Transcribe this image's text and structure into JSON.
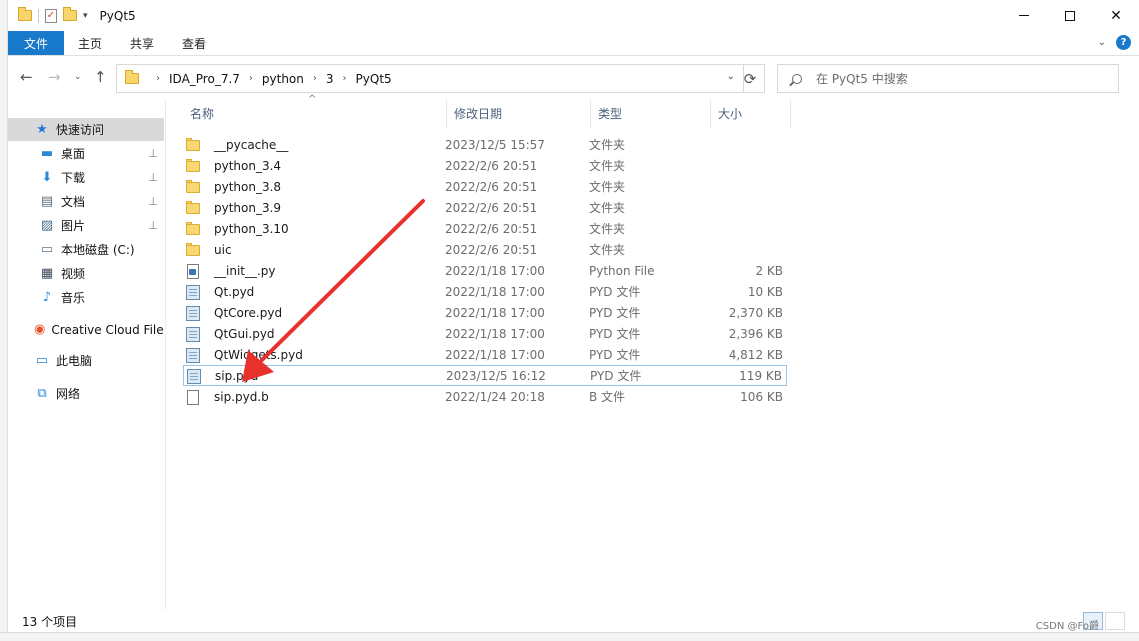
{
  "window": {
    "title": "PyQt5",
    "controls": {
      "minimize": "minimize",
      "maximize": "maximize",
      "close": "✕"
    }
  },
  "ribbon": {
    "tabs": [
      "文件",
      "主页",
      "共享",
      "查看"
    ],
    "help": "?"
  },
  "address": {
    "crumbs": [
      "IDA_Pro_7.7",
      "python",
      "3",
      "PyQt5"
    ]
  },
  "search": {
    "placeholder": "在 PyQt5 中搜索"
  },
  "nav": {
    "items": [
      {
        "label": "快速访问",
        "icon": "star-icon",
        "pinned": false
      },
      {
        "label": "桌面",
        "icon": "desktop-icon",
        "pinned": true
      },
      {
        "label": "下载",
        "icon": "download-icon",
        "pinned": true
      },
      {
        "label": "文档",
        "icon": "document-icon",
        "pinned": true
      },
      {
        "label": "图片",
        "icon": "pictures-icon",
        "pinned": true
      },
      {
        "label": "本地磁盘 (C:)",
        "icon": "drive-icon",
        "pinned": false
      },
      {
        "label": "视频",
        "icon": "video-icon",
        "pinned": false
      },
      {
        "label": "音乐",
        "icon": "music-icon",
        "pinned": false
      },
      {
        "label": "Creative Cloud Files",
        "icon": "creative-cloud-icon",
        "pinned": false
      },
      {
        "label": "此电脑",
        "icon": "computer-icon",
        "pinned": false
      },
      {
        "label": "网络",
        "icon": "network-icon",
        "pinned": false
      }
    ]
  },
  "columns": {
    "name": "名称",
    "date": "修改日期",
    "type": "类型",
    "size": "大小"
  },
  "files": [
    {
      "name": "__pycache__",
      "date": "2023/12/5 15:57",
      "type": "文件夹",
      "size": "",
      "icon": "folder"
    },
    {
      "name": "python_3.4",
      "date": "2022/2/6 20:51",
      "type": "文件夹",
      "size": "",
      "icon": "folder"
    },
    {
      "name": "python_3.8",
      "date": "2022/2/6 20:51",
      "type": "文件夹",
      "size": "",
      "icon": "folder"
    },
    {
      "name": "python_3.9",
      "date": "2022/2/6 20:51",
      "type": "文件夹",
      "size": "",
      "icon": "folder"
    },
    {
      "name": "python_3.10",
      "date": "2022/2/6 20:51",
      "type": "文件夹",
      "size": "",
      "icon": "folder"
    },
    {
      "name": "uic",
      "date": "2022/2/6 20:51",
      "type": "文件夹",
      "size": "",
      "icon": "folder"
    },
    {
      "name": "__init__.py",
      "date": "2022/1/18 17:00",
      "type": "Python File",
      "size": "2 KB",
      "icon": "py"
    },
    {
      "name": "Qt.pyd",
      "date": "2022/1/18 17:00",
      "type": "PYD 文件",
      "size": "10 KB",
      "icon": "pyd"
    },
    {
      "name": "QtCore.pyd",
      "date": "2022/1/18 17:00",
      "type": "PYD 文件",
      "size": "2,370 KB",
      "icon": "pyd"
    },
    {
      "name": "QtGui.pyd",
      "date": "2022/1/18 17:00",
      "type": "PYD 文件",
      "size": "2,396 KB",
      "icon": "pyd"
    },
    {
      "name": "QtWidgets.pyd",
      "date": "2022/1/18 17:00",
      "type": "PYD 文件",
      "size": "4,812 KB",
      "icon": "pyd"
    },
    {
      "name": "sip.pyd",
      "date": "2023/12/5 16:12",
      "type": "PYD 文件",
      "size": "119 KB",
      "icon": "pyd",
      "focused": true
    },
    {
      "name": "sip.pyd.b",
      "date": "2022/1/24 20:18",
      "type": "B 文件",
      "size": "106 KB",
      "icon": "doc"
    }
  ],
  "status": {
    "count": "13 个项目"
  },
  "watermark": "CSDN @Fo爵",
  "annotation": {
    "arrow_color": "#e8302c"
  }
}
